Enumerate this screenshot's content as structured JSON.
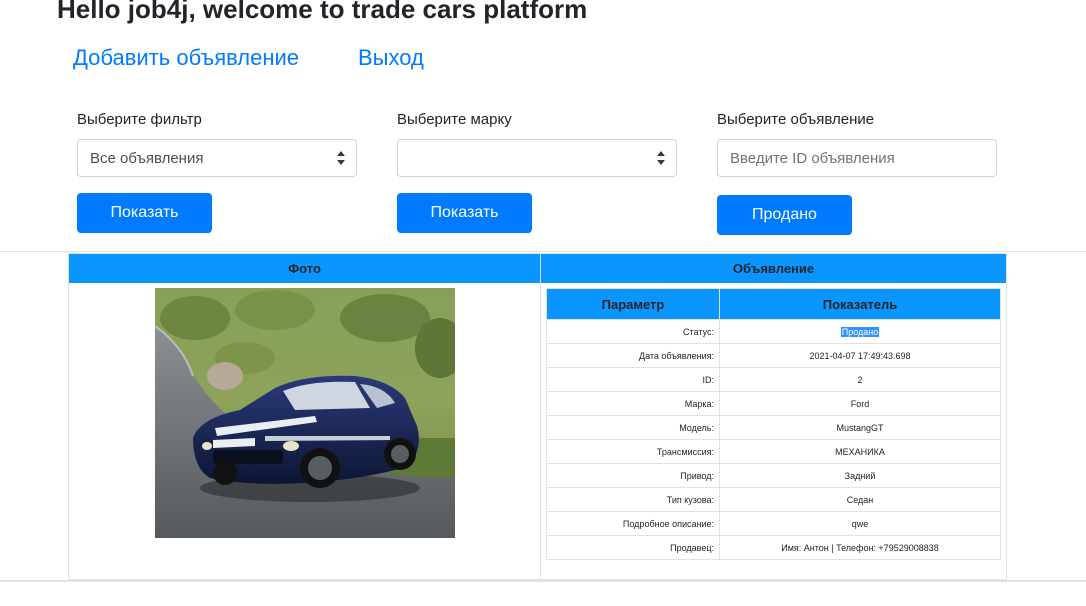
{
  "header": {
    "greeting": "Hello job4j, welcome to trade cars platform",
    "nav": {
      "add_ad": "Добавить объявление",
      "logout": "Выход"
    }
  },
  "filters": {
    "filter": {
      "label": "Выберите фильтр",
      "selected": "Все объявления",
      "button": "Показать"
    },
    "brand": {
      "label": "Выберите марку",
      "selected": "",
      "button": "Показать"
    },
    "ad": {
      "label": "Выберите объявление",
      "placeholder": "Введите ID объявления",
      "button": "Продано"
    }
  },
  "table": {
    "headers": {
      "photo": "Фото",
      "ad": "Объявление"
    },
    "details": {
      "headers": {
        "param": "Параметр",
        "value": "Показатель"
      },
      "rows": [
        {
          "param": "Статус:",
          "value": "Продано"
        },
        {
          "param": "Дата объявления:",
          "value": "2021-04-07 17:49:43.698"
        },
        {
          "param": "ID:",
          "value": "2"
        },
        {
          "param": "Марка:",
          "value": "Ford"
        },
        {
          "param": "Модель:",
          "value": "MustangGT"
        },
        {
          "param": "Трансмиссия:",
          "value": "МЕХАНИКА"
        },
        {
          "param": "Привод:",
          "value": "Задний"
        },
        {
          "param": "Тип кузова:",
          "value": "Седан"
        },
        {
          "param": "Подробное описание:",
          "value": "qwe"
        },
        {
          "param": "Продавец:",
          "value": "Имя: Антон | Телефон: +79529008838"
        }
      ]
    }
  },
  "colors": {
    "accent": "#007bff",
    "table_header": "#0a95ff",
    "selection": "#3390ff"
  }
}
